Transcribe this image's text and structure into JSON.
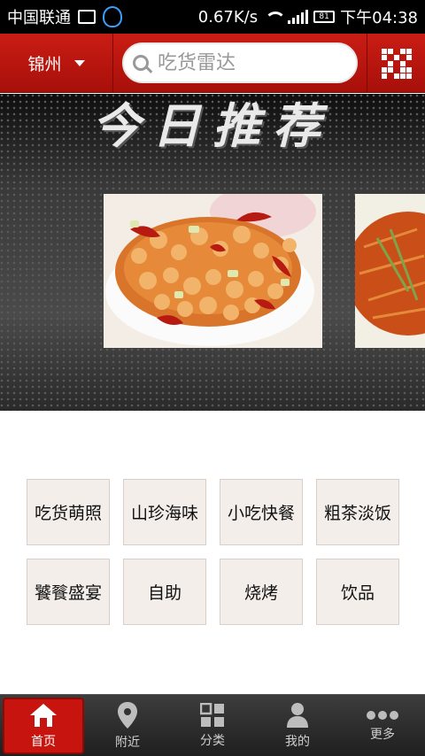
{
  "status_bar": {
    "carrier": "中国联通",
    "speed": "0.67K/s",
    "battery": "81",
    "time": "下午04:38"
  },
  "header": {
    "city": "锦州",
    "search_placeholder": "吃货雷达"
  },
  "banner": {
    "title": "今日推荐"
  },
  "categories": [
    {
      "label": "吃货萌照"
    },
    {
      "label": "山珍海味"
    },
    {
      "label": "小吃快餐"
    },
    {
      "label": "粗茶淡饭"
    },
    {
      "label": "饕餮盛宴"
    },
    {
      "label": "自助"
    },
    {
      "label": "烧烤"
    },
    {
      "label": "饮品"
    }
  ],
  "tabs": [
    {
      "label": "首页",
      "icon": "home-icon"
    },
    {
      "label": "附近",
      "icon": "location-pin-icon"
    },
    {
      "label": "分类",
      "icon": "grid-icon"
    },
    {
      "label": "我的",
      "icon": "user-icon"
    },
    {
      "label": "更多",
      "icon": "more-icon"
    }
  ],
  "colors": {
    "brand_red": "#c8140e",
    "tab_bar": "#2a2a2a"
  }
}
